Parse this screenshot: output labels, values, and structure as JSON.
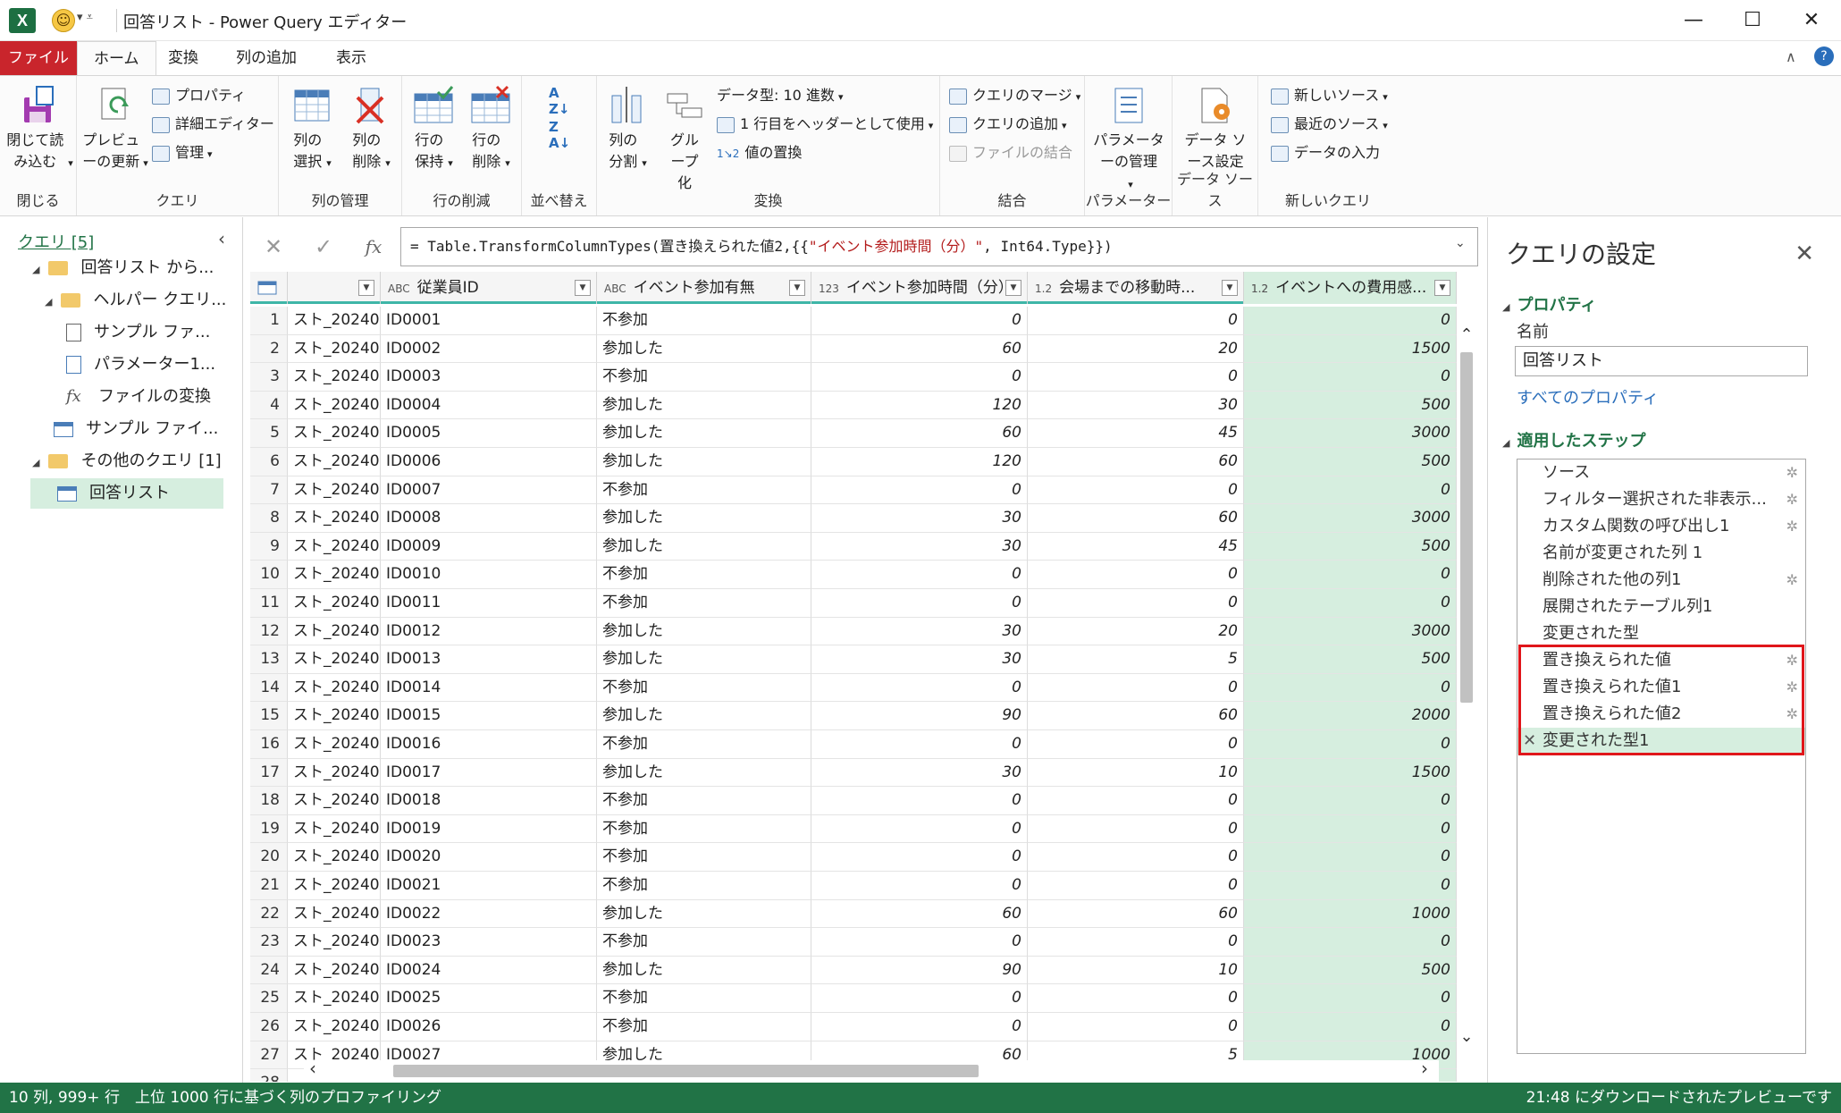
{
  "window": {
    "title": "回答リスト - Power Query エディター",
    "app_icon": "excel-icon",
    "minimize": "—",
    "maximize": "☐",
    "close": "✕"
  },
  "tabs": [
    "ファイル",
    "ホーム",
    "変換",
    "列の追加",
    "表示"
  ],
  "active_tab": "ホーム",
  "ribbon": {
    "close_load": "閉じて読み込む",
    "close_group": "閉じる",
    "preview_refresh": "プレビューの更新",
    "properties": "プロパティ",
    "advanced_editor": "詳細エディター",
    "manage": "管理",
    "query_group": "クエリ",
    "choose_columns": "列の選択",
    "remove_columns": "列の削除",
    "columns_group": "列の管理",
    "keep_rows": "行の保持",
    "remove_rows": "行の削除",
    "rows_group": "行の削減",
    "sort_group": "並べ替え",
    "split_column": "列の分割",
    "group_by": "グループ化",
    "data_type": "データ型: 10 進数",
    "use_first_row": "1 行目をヘッダーとして使用",
    "replace_values": "値の置換",
    "transform_group": "変換",
    "merge_queries": "クエリのマージ",
    "append_queries": "クエリの追加",
    "combine_files": "ファイルの結合",
    "combine_group": "結合",
    "manage_parameters": "パラメーターの管理",
    "parameters_group": "パラメーター",
    "data_source_settings": "データ ソース設定",
    "datasource_group": "データ ソース",
    "new_source": "新しいソース",
    "recent_sources": "最近のソース",
    "enter_data": "データの入力",
    "newquery_group": "新しいクエリ"
  },
  "queries_pane": {
    "header": "クエリ [5]",
    "items": [
      {
        "label": "回答リスト から...",
        "icon": "folder-icon",
        "level": 0,
        "expanded": true
      },
      {
        "label": "ヘルパー クエリ...",
        "icon": "folder-icon",
        "level": 1,
        "expanded": true
      },
      {
        "label": "サンプル ファ...",
        "icon": "document-icon",
        "level": 2
      },
      {
        "label": "パラメーター1...",
        "icon": "parameter-icon",
        "level": 2
      },
      {
        "label": "ファイルの変換",
        "icon": "function-icon",
        "level": 2
      },
      {
        "label": "サンプル ファイ...",
        "icon": "table-icon",
        "level": 1
      },
      {
        "label": "その他のクエリ [1]",
        "icon": "folder-icon",
        "level": 0,
        "expanded": true
      },
      {
        "label": "回答リスト",
        "icon": "table-icon",
        "level": 1,
        "selected": true
      }
    ]
  },
  "formula_bar": {
    "prefix": "= Table.TransformColumnTypes(置き換えられた値2,{{",
    "string": "\"イベント参加時間（分）\"",
    "suffix": ", Int64.Type}})",
    "fx": "fx"
  },
  "grid": {
    "columns": [
      {
        "type": "",
        "label": ""
      },
      {
        "type": "ABC",
        "label": "従業員ID"
      },
      {
        "type": "ABC",
        "label": "イベント参加有無"
      },
      {
        "type": "123",
        "label": "イベント参加時間（分）"
      },
      {
        "type": "1.2",
        "label": "会場までの移動時..."
      },
      {
        "type": "1.2",
        "label": "イベントへの費用感..."
      },
      {
        "type": "1.2",
        "label": ""
      }
    ],
    "rows": [
      [
        "1",
        "スト_20240...",
        "ID0001",
        "不参加",
        "0",
        "0",
        "0"
      ],
      [
        "2",
        "スト_20240...",
        "ID0002",
        "参加した",
        "60",
        "20",
        "1500"
      ],
      [
        "3",
        "スト_20240...",
        "ID0003",
        "不参加",
        "0",
        "0",
        "0"
      ],
      [
        "4",
        "スト_20240...",
        "ID0004",
        "参加した",
        "120",
        "30",
        "500"
      ],
      [
        "5",
        "スト_20240...",
        "ID0005",
        "参加した",
        "60",
        "45",
        "3000"
      ],
      [
        "6",
        "スト_20240...",
        "ID0006",
        "参加した",
        "120",
        "60",
        "500"
      ],
      [
        "7",
        "スト_20240...",
        "ID0007",
        "不参加",
        "0",
        "0",
        "0"
      ],
      [
        "8",
        "スト_20240...",
        "ID0008",
        "参加した",
        "30",
        "60",
        "3000"
      ],
      [
        "9",
        "スト_20240...",
        "ID0009",
        "参加した",
        "30",
        "45",
        "500"
      ],
      [
        "10",
        "スト_20240...",
        "ID0010",
        "不参加",
        "0",
        "0",
        "0"
      ],
      [
        "11",
        "スト_20240...",
        "ID0011",
        "不参加",
        "0",
        "0",
        "0"
      ],
      [
        "12",
        "スト_20240...",
        "ID0012",
        "参加した",
        "30",
        "20",
        "3000"
      ],
      [
        "13",
        "スト_20240...",
        "ID0013",
        "参加した",
        "30",
        "5",
        "500"
      ],
      [
        "14",
        "スト_20240...",
        "ID0014",
        "不参加",
        "0",
        "0",
        "0"
      ],
      [
        "15",
        "スト_20240...",
        "ID0015",
        "参加した",
        "90",
        "60",
        "2000"
      ],
      [
        "16",
        "スト_20240...",
        "ID0016",
        "不参加",
        "0",
        "0",
        "0"
      ],
      [
        "17",
        "スト_20240...",
        "ID0017",
        "参加した",
        "30",
        "10",
        "1500"
      ],
      [
        "18",
        "スト_20240...",
        "ID0018",
        "不参加",
        "0",
        "0",
        "0"
      ],
      [
        "19",
        "スト_20240...",
        "ID0019",
        "不参加",
        "0",
        "0",
        "0"
      ],
      [
        "20",
        "スト_20240...",
        "ID0020",
        "不参加",
        "0",
        "0",
        "0"
      ],
      [
        "21",
        "スト_20240...",
        "ID0021",
        "不参加",
        "0",
        "0",
        "0"
      ],
      [
        "22",
        "スト_20240...",
        "ID0022",
        "参加した",
        "60",
        "60",
        "1000"
      ],
      [
        "23",
        "スト_20240...",
        "ID0023",
        "不参加",
        "0",
        "0",
        "0"
      ],
      [
        "24",
        "スト_20240...",
        "ID0024",
        "参加した",
        "90",
        "10",
        "500"
      ],
      [
        "25",
        "スト_20240...",
        "ID0025",
        "不参加",
        "0",
        "0",
        "0"
      ],
      [
        "26",
        "スト_20240...",
        "ID0026",
        "不参加",
        "0",
        "0",
        "0"
      ],
      [
        "27",
        "スト_20240...",
        "ID0027",
        "参加した",
        "60",
        "5",
        "1000"
      ],
      [
        "28",
        "",
        "",
        "",
        "",
        "",
        ""
      ]
    ]
  },
  "query_settings": {
    "title": "クエリの設定",
    "properties_header": "プロパティ",
    "name_label": "名前",
    "name_value": "回答リスト",
    "all_properties": "すべてのプロパティ",
    "applied_steps_header": "適用したステップ",
    "steps": [
      {
        "label": "ソース",
        "gear": true
      },
      {
        "label": "フィルター選択された非表示...",
        "gear": true
      },
      {
        "label": "カスタム関数の呼び出し1",
        "gear": true
      },
      {
        "label": "名前が変更された列 1",
        "gear": false
      },
      {
        "label": "削除された他の列1",
        "gear": true
      },
      {
        "label": "展開されたテーブル列1",
        "gear": false
      },
      {
        "label": "変更された型",
        "gear": false
      },
      {
        "label": "置き換えられた値",
        "gear": true
      },
      {
        "label": "置き換えられた値1",
        "gear": true
      },
      {
        "label": "置き換えられた値2",
        "gear": true
      },
      {
        "label": "変更された型1",
        "gear": false,
        "selected": true
      }
    ],
    "highlight_color": "#e0161b"
  },
  "status": {
    "left": "10 列, 999+ 行　上位 1000 行に基づく列のプロファイリング",
    "right": "21:48 にダウンロードされたプレビューです"
  },
  "colors": {
    "excel_green": "#217346",
    "file_tab_red": "#c9252c",
    "selected_column": "#d6eedf",
    "header_accent": "#3fb6a8"
  }
}
